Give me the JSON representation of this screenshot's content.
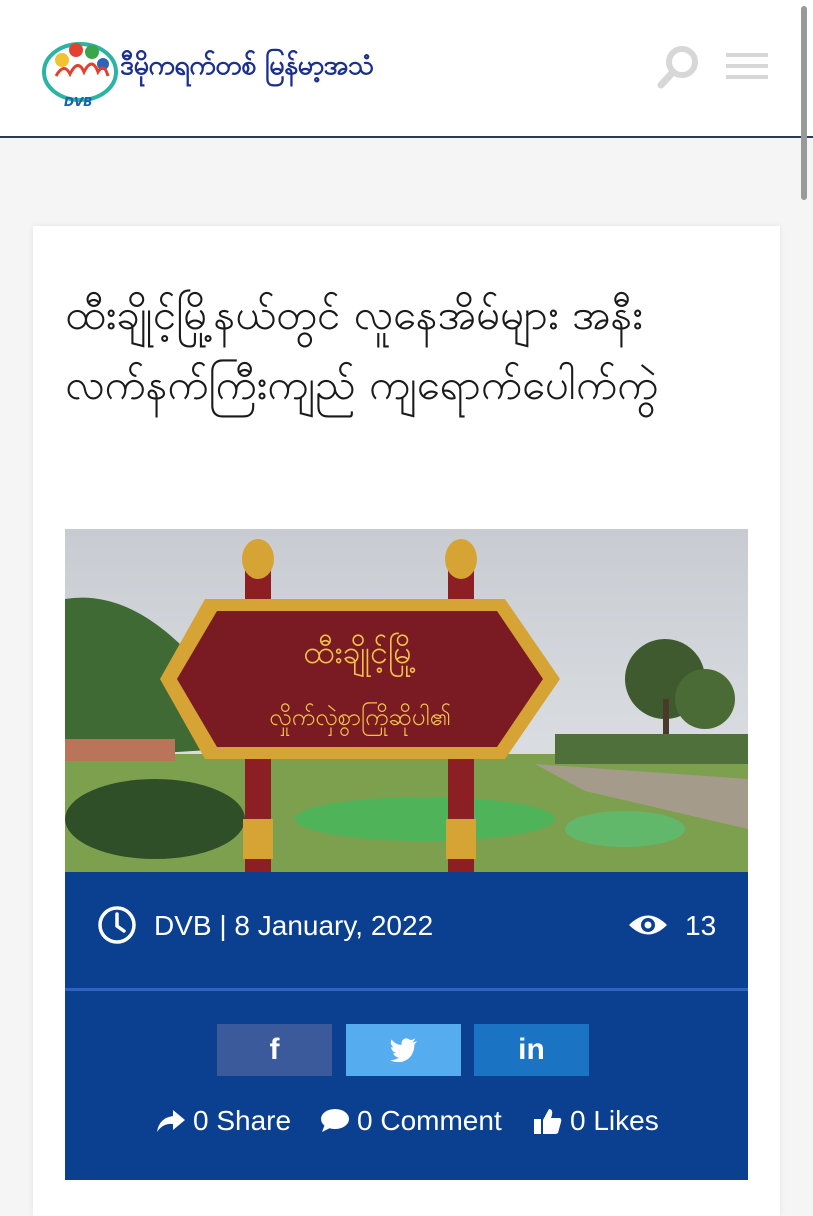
{
  "header": {
    "brand_text": "ဒီမိုကရက်တစ် မြန်မာ့အသံ",
    "logo_text": "DVB",
    "search_icon": "search-icon",
    "menu_icon": "hamburger-menu-icon"
  },
  "article": {
    "title": "ထီးချိုင့်မြို့နယ်တွင် လူနေအိမ်များ အနီး လက်နက်ကြီးကျည် ကျရောက်ပေါက်ကွဲ",
    "image_sign_line1": "ထီးချိုင့်မြို့",
    "image_sign_line2": "လှိုက်လှဲစွာကြိုဆိုပါ၏",
    "author_date": "DVB | 8 January, 2022",
    "views": "13",
    "meta_icons": {
      "time": "clock-icon",
      "views": "eye-icon"
    }
  },
  "share": {
    "facebook_label": "f",
    "twitter_icon": "twitter-bird-icon",
    "linkedin_label": "in",
    "share_count_label": "0 Share",
    "comment_count_label": "0 Comment",
    "likes_count_label": "0 Likes"
  },
  "colors": {
    "brand_blue": "#1b2f8c",
    "meta_bar": "#0b3f8f",
    "facebook": "#3a5a9c",
    "twitter": "#55acee",
    "linkedin": "#1b73c3"
  }
}
